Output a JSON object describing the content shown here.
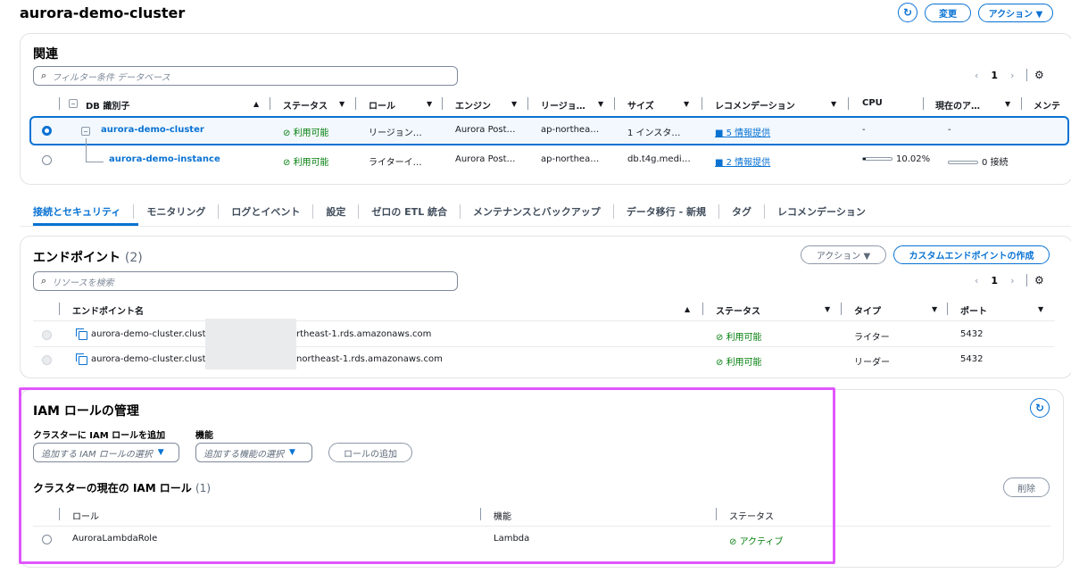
{
  "page": {
    "title": "aurora-demo-cluster",
    "buttons": {
      "modify": "変更",
      "actions": "アクション ▼"
    }
  },
  "related": {
    "heading": "関連",
    "filter_placeholder": "フィルター条件 データベース",
    "page": "1",
    "columns": [
      "DB 識別子",
      "ステータス",
      "ロール",
      "エンジン",
      "リージョ…",
      "サイズ",
      "レコメンデーション",
      "CPU",
      "現在のア…",
      "メンテ"
    ],
    "rows": [
      {
        "id": "aurora-demo-cluster",
        "status": "利用可能",
        "role": "リージョン…",
        "engine": "Aurora Post…",
        "region": "ap-northea…",
        "size": "1 インスタ…",
        "rec": "5 情報提供",
        "cpu": "-",
        "current": "-"
      },
      {
        "id": "aurora-demo-instance",
        "status": "利用可能",
        "role": "ライターイ…",
        "engine": "Aurora Post…",
        "region": "ap-northea…",
        "size": "db.t4g.medi…",
        "rec": "2 情報提供",
        "cpu": "10.02%",
        "cpu_value": 0.1002,
        "current": "0 接続"
      }
    ]
  },
  "tabs": [
    "接続とセキュリティ",
    "モニタリング",
    "ログとイベント",
    "設定",
    "ゼロの ETL 統合",
    "メンテナンスとバックアップ",
    "データ移行 - 新規",
    "タグ",
    "レコメンデーション"
  ],
  "endpoints": {
    "heading": "エンドポイント",
    "count": "(2)",
    "actions": "アクション ▼",
    "create": "カスタムエンドポイントの作成",
    "search_placeholder": "リソースを検索",
    "page": "1",
    "columns": [
      "エンドポイント名",
      "ステータス",
      "タイプ",
      "ポート"
    ],
    "rows": [
      {
        "name_a": "aurora-demo-cluster.cluster",
        "name_b": "rtheast-1.rds.amazonaws.com",
        "status": "利用可能",
        "type": "ライター",
        "port": "5432"
      },
      {
        "name_a": "aurora-demo-cluster.cluster",
        "name_b": "northeast-1.rds.amazonaws.com",
        "status": "利用可能",
        "type": "リーダー",
        "port": "5432"
      }
    ]
  },
  "iam": {
    "heading": "IAM ロールの管理",
    "add_label": "クラスターに IAM ロールを追加",
    "feature_label": "機能",
    "role_select": "追加する IAM ロールの選択",
    "feature_select": "追加する機能の選択",
    "add_button": "ロールの追加",
    "current_heading": "クラスターの現在の IAM ロール",
    "current_count": "(1)",
    "delete": "削除",
    "columns": [
      "ロール",
      "機能",
      "ステータス"
    ],
    "rows": [
      {
        "role": "AuroraLambdaRole",
        "feature": "Lambda",
        "status": "アクティブ"
      }
    ]
  },
  "colors": {
    "accent": "#0972d3",
    "success": "#037f0c",
    "highlight": "#e056fd"
  }
}
